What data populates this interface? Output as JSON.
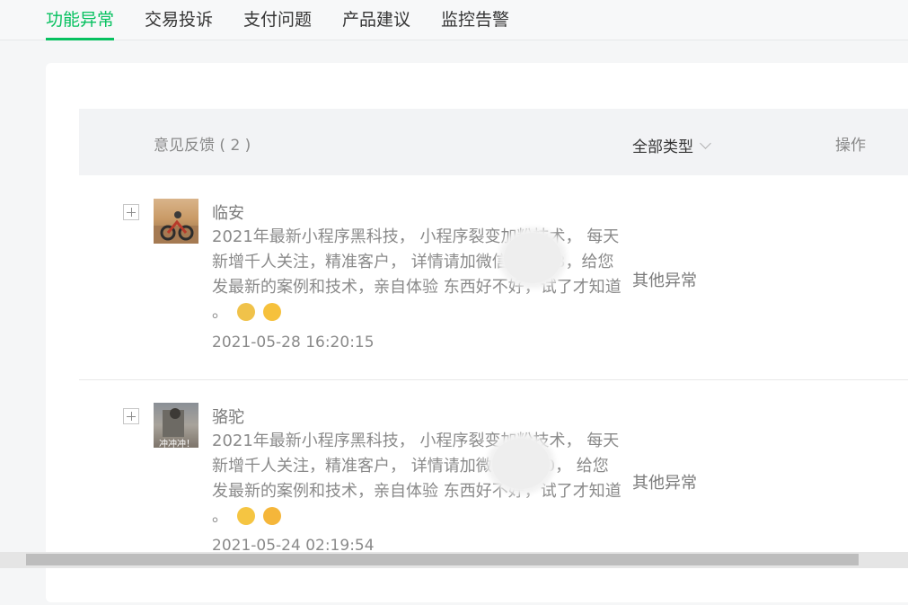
{
  "tabs": [
    {
      "label": "功能异常",
      "active": true
    },
    {
      "label": "交易投诉",
      "active": false
    },
    {
      "label": "支付问题",
      "active": false
    },
    {
      "label": "产品建议",
      "active": false
    },
    {
      "label": "监控告警",
      "active": false
    }
  ],
  "table": {
    "title": "意见反馈 ( 2 )",
    "filter_label": "全部类型",
    "op_header": "操作"
  },
  "rows": [
    {
      "nickname": "临安",
      "content": "2021年最新小程序黑科技， 小程序裂变加粉技术， 每天新增千人关注，精准客户， 详情请加微信：4513，给您发最新的案例和技术，亲自体验 东西好不好，试了才知道 。",
      "emojis": [
        "cat-emoji",
        "heart-eyes-emoji"
      ],
      "time": "2021-05-28 16:20:15",
      "type": "其他异常"
    },
    {
      "nickname": "骆驼",
      "content": "2021年最新小程序黑科技， 小程序裂变加粉技术， 每天新增千人关注，精准客户， 详情请加微信：480， 给您发最新的案例和技术，亲自体验 东西好不好，试了才知道 。",
      "avatar_caption": "冲冲冲！",
      "emojis": [
        "smile-emoji",
        "tongue-emoji"
      ],
      "time": "2021-05-24 02:19:54",
      "type": "其他异常"
    }
  ],
  "colors": {
    "accent": "#07c160",
    "header_bg": "#f2f3f5"
  }
}
